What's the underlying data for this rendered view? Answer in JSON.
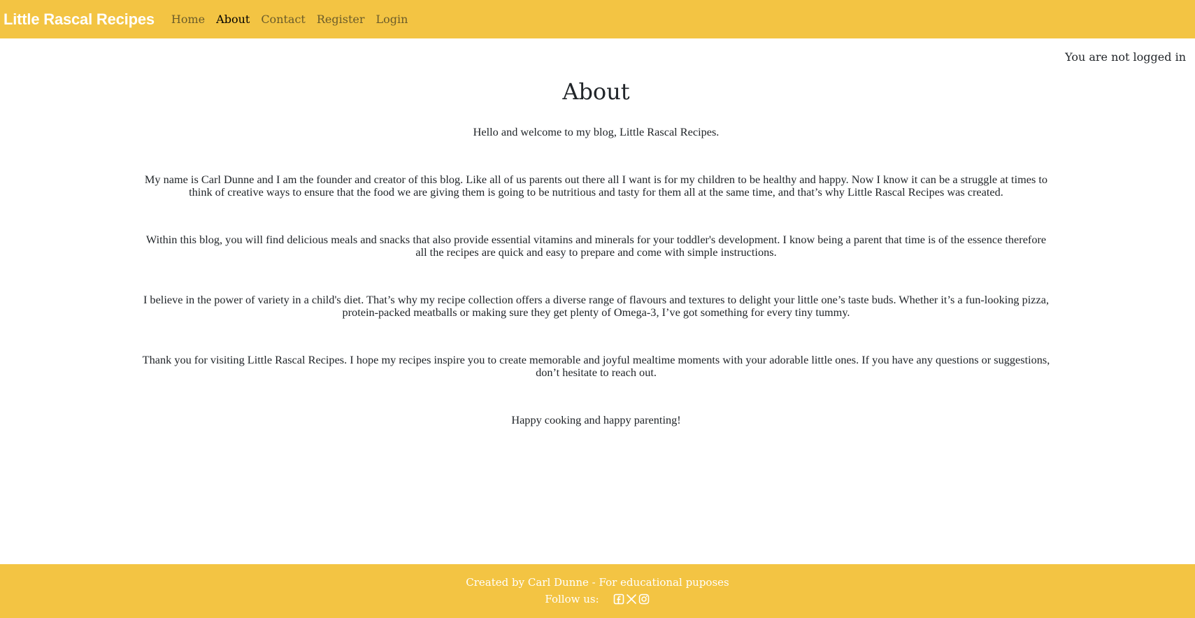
{
  "navbar": {
    "brand": "Little Rascal Recipes",
    "items": [
      {
        "label": "Home",
        "active": false
      },
      {
        "label": "About",
        "active": true
      },
      {
        "label": "Contact",
        "active": false
      },
      {
        "label": "Register",
        "active": false
      },
      {
        "label": "Login",
        "active": false
      }
    ]
  },
  "status": {
    "login_text": "You are not logged in"
  },
  "main": {
    "title": "About",
    "paragraphs": [
      "Hello and welcome to my blog, Little Rascal Recipes.",
      "My name is Carl Dunne and I am the founder and creator of this blog. Like all of us parents out there all I want is for my children to be healthy and happy. Now I know it can be a struggle at times to think of creative ways to ensure that the food we are giving them is going to be nutritious and tasty for them all at the same time, and that’s why Little Rascal Recipes was created.",
      "Within this blog, you will find delicious meals and snacks that also provide essential vitamins and minerals for your toddler's development. I know being a parent that time is of the essence therefore all the recipes are quick and easy to prepare and come with simple instructions.",
      "I believe in the power of variety in a child's diet. That’s why my recipe collection offers a diverse range of flavours and textures to delight your little one’s taste buds. Whether it’s a fun-looking pizza, protein-packed meatballs or making sure they get plenty of Omega-3, I’ve got something for every tiny tummy.",
      "Thank you for visiting Little Rascal Recipes. I hope my recipes inspire you to create memorable and joyful mealtime moments with your adorable little ones. If you have any questions or suggestions, don’t hesitate to reach out.",
      "Happy cooking and happy parenting!"
    ]
  },
  "footer": {
    "credit": "Created by Carl Dunne - For educational puposes",
    "follow_label": "Follow us:",
    "social_icons": [
      "facebook-icon",
      "x-twitter-icon",
      "instagram-icon"
    ]
  },
  "colors": {
    "brand_yellow": "#f3c443",
    "text": "#212529",
    "nav_link": "#6b5c2a",
    "nav_active": "#000000",
    "footer_text": "#ffffff"
  }
}
